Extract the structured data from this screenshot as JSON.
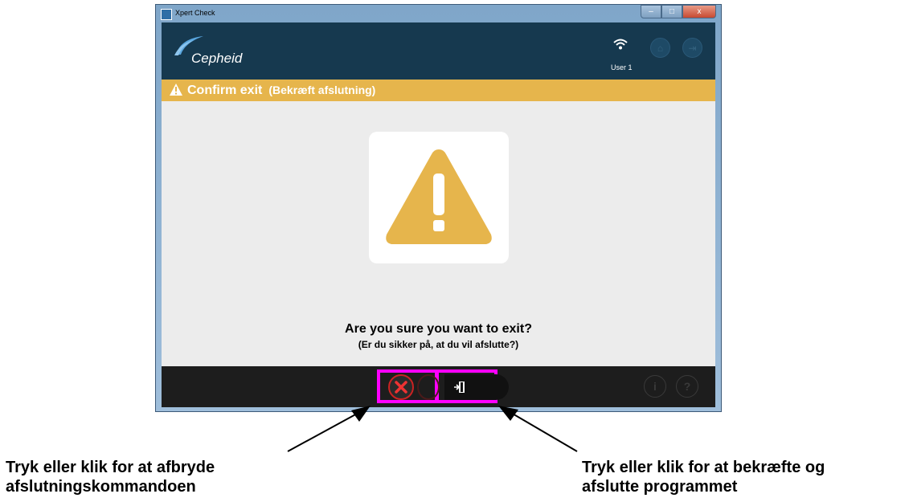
{
  "window": {
    "title": "Xpert Check",
    "controls": [
      "–",
      "□",
      "x"
    ]
  },
  "header": {
    "brand": "Cepheid",
    "user": "User 1",
    "home_icon": "⌂",
    "exit_icon": "⇥"
  },
  "banner": {
    "title": "Confirm exit",
    "subtitle": "(Bekræft afslutning)",
    "color": "#e6b54c"
  },
  "dialog": {
    "question": "Are you sure you want to exit?",
    "question_da": "(Er du sikker på, at du vil afslutte?)"
  },
  "footer": {
    "info": "i",
    "help": "?"
  },
  "callouts": {
    "cancel_line1": "Tryk eller klik for at afbryde",
    "cancel_line2": "afslutningskommandoen",
    "confirm_line1": "Tryk eller klik for at bekræfte og",
    "confirm_line2": "afslutte programmet"
  },
  "colors": {
    "header": "#16394f",
    "highlight": "#ff00ff",
    "cancel": "#cc2222"
  }
}
